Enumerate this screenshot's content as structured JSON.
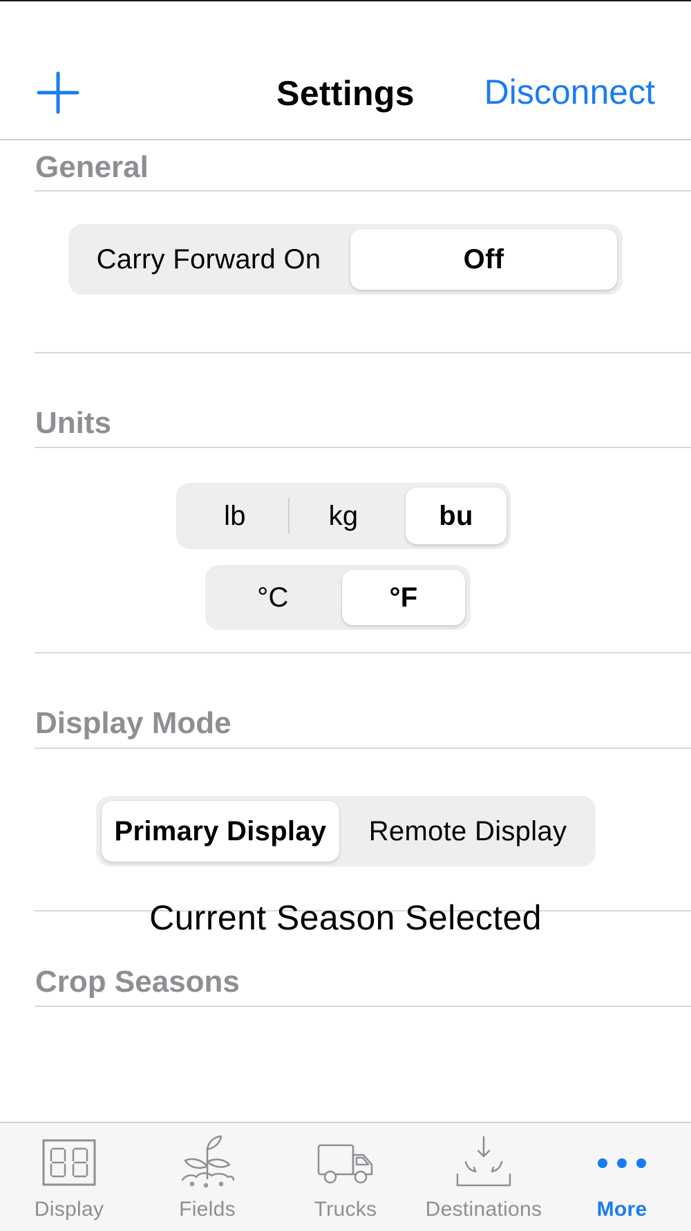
{
  "nav": {
    "title": "Settings",
    "add_icon": "plus-icon",
    "disconnect_label": "Disconnect",
    "accent_color": "#1a7cf2"
  },
  "sections": {
    "general": {
      "header": "General",
      "carry_forward": {
        "options": [
          "Carry Forward On",
          "Off"
        ],
        "selected": "Off"
      }
    },
    "units": {
      "header": "Units",
      "weight": {
        "options": [
          "lb",
          "kg",
          "bu"
        ],
        "selected": "bu"
      },
      "temperature": {
        "options": [
          "°C",
          "°F"
        ],
        "selected": "°F"
      }
    },
    "display_mode": {
      "header": "Display Mode",
      "options": [
        "Primary Display",
        "Remote Display"
      ],
      "selected": "Primary Display"
    },
    "crop_seasons": {
      "header": "Crop Seasons",
      "status": "Current Season Selected"
    }
  },
  "tabbar": {
    "tabs": [
      {
        "label": "Display",
        "icon": "seven-segment-display-icon"
      },
      {
        "label": "Fields",
        "icon": "plant-sprout-icon"
      },
      {
        "label": "Trucks",
        "icon": "truck-icon"
      },
      {
        "label": "Destinations",
        "icon": "unload-arrows-icon"
      },
      {
        "label": "More",
        "icon": "more-dots-icon"
      }
    ],
    "active": "More",
    "inactive_color": "#8e8e93",
    "active_color": "#1a7cf2"
  }
}
